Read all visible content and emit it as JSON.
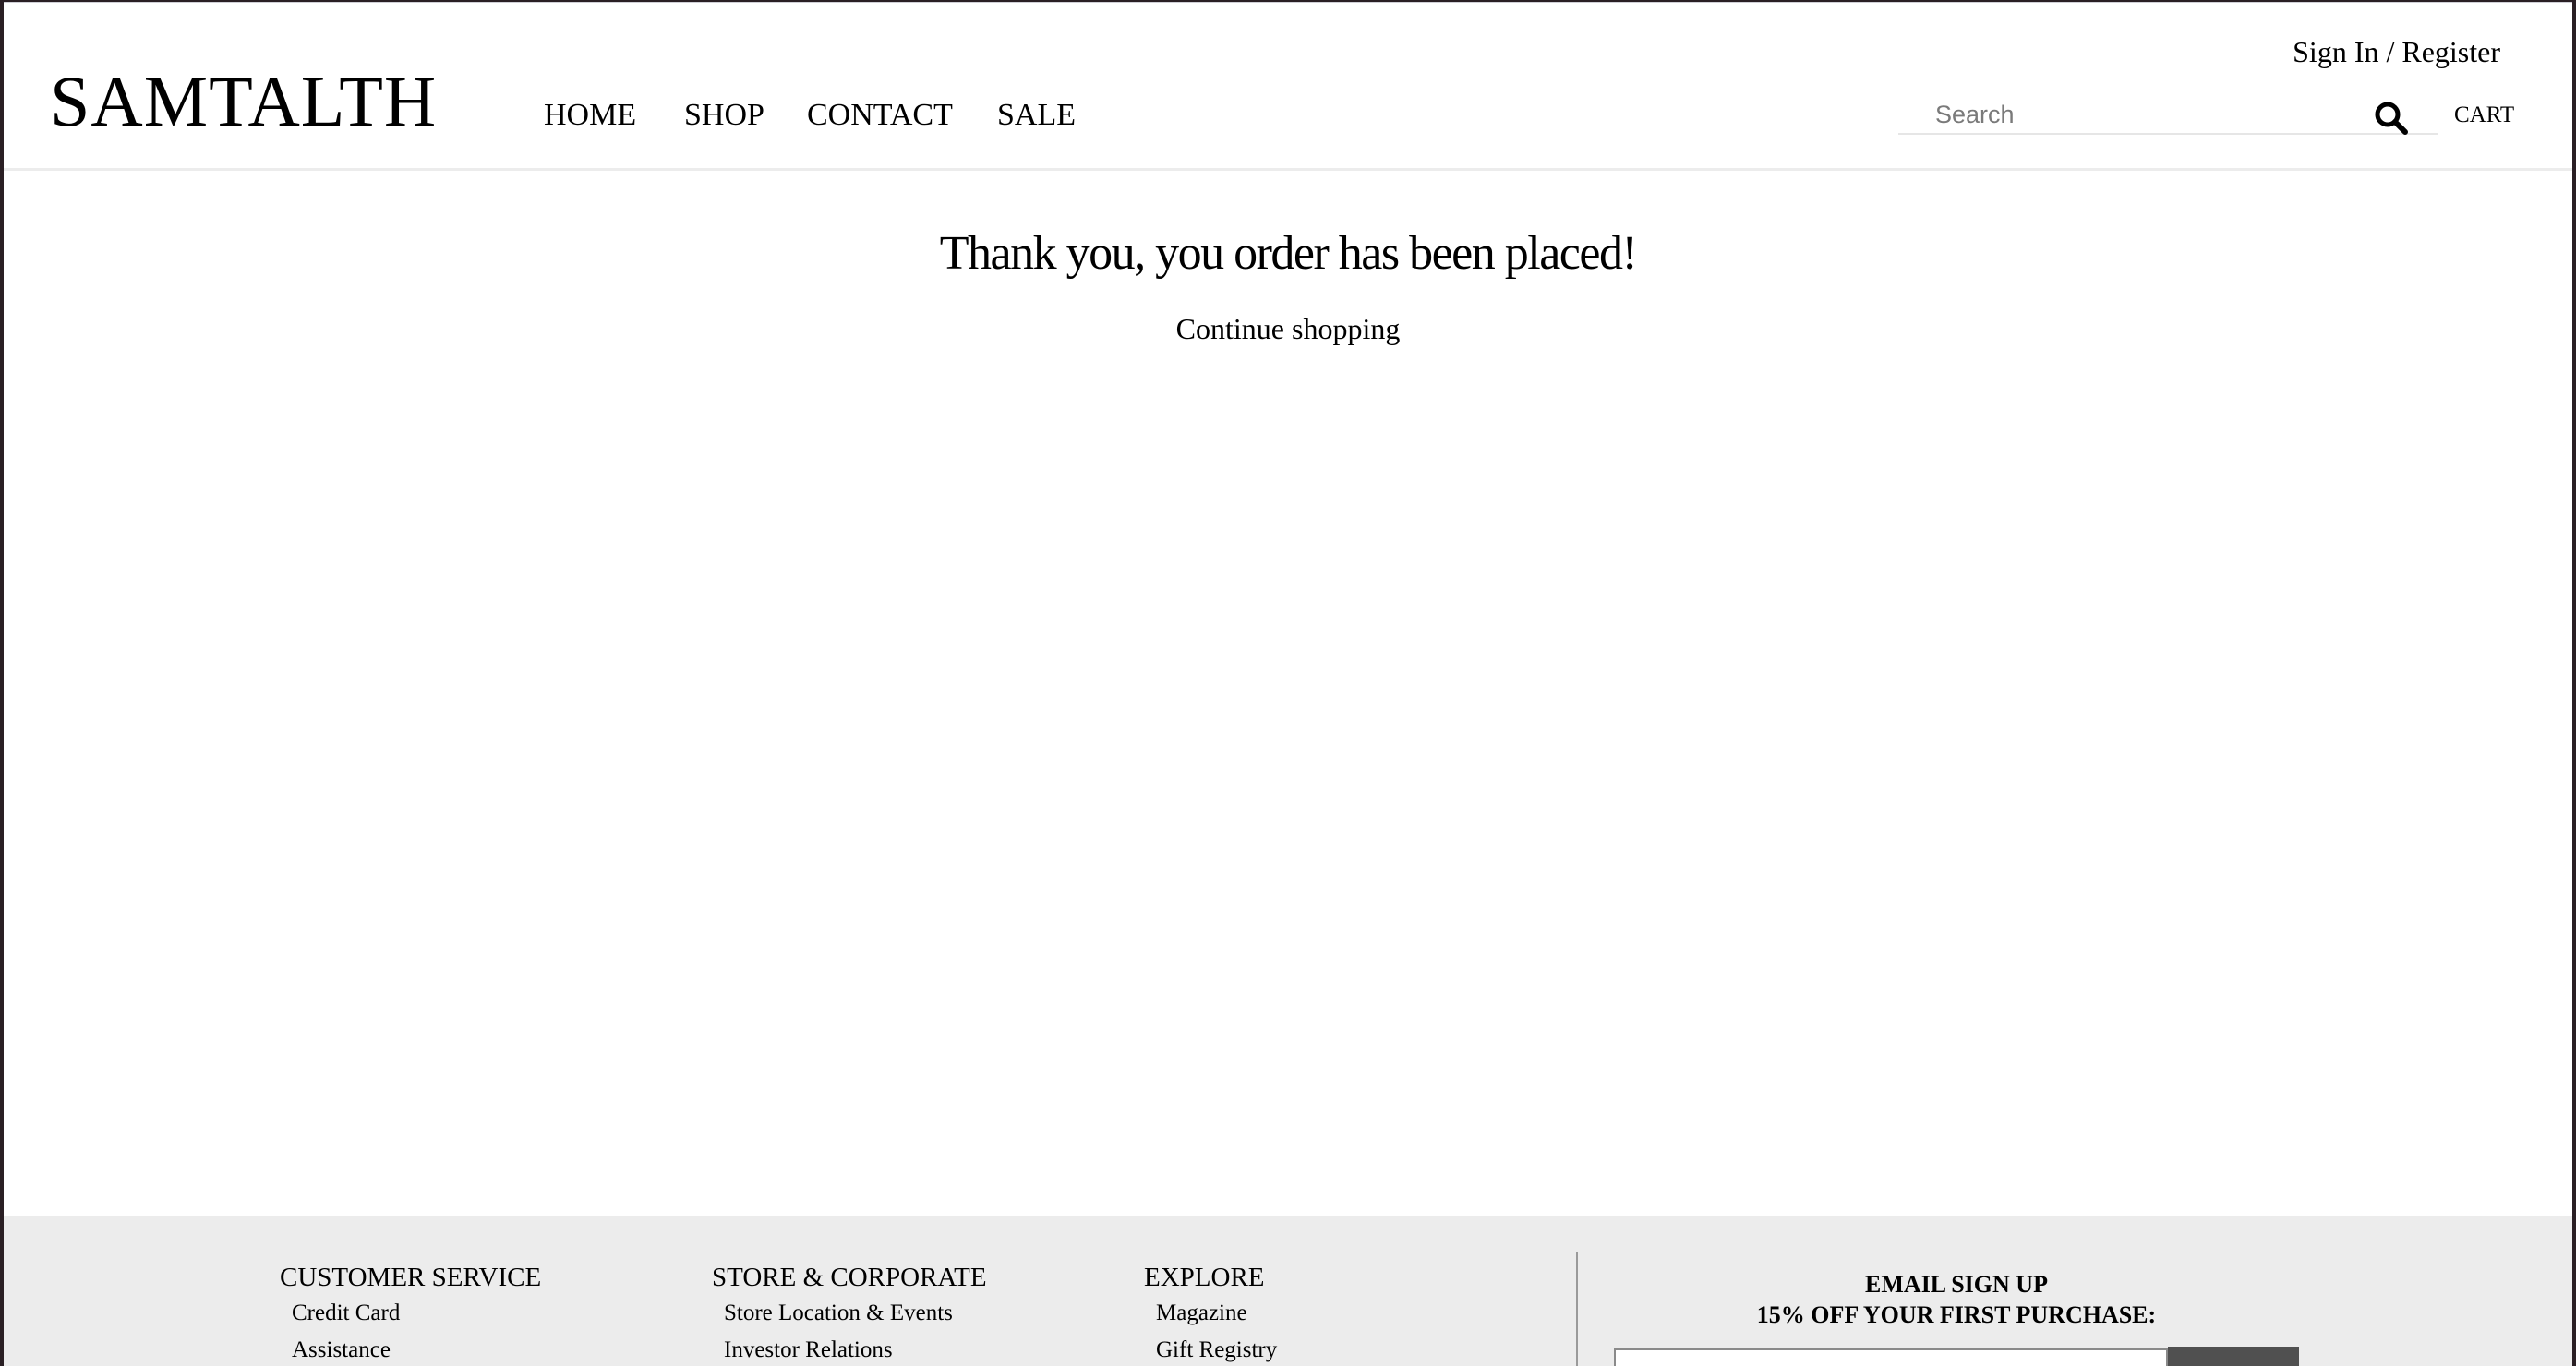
{
  "header": {
    "logo": "SAMTALTH",
    "nav": [
      {
        "label": "HOME"
      },
      {
        "label": "SHOP"
      },
      {
        "label": "CONTACT"
      },
      {
        "label": "SALE"
      }
    ],
    "sign_in": "Sign In / Register",
    "search": {
      "placeholder": "Search",
      "value": "",
      "icon": "search-icon"
    },
    "cart": "CART"
  },
  "main": {
    "heading": "Thank you, you order has been placed!",
    "continue_link": "Continue shopping"
  },
  "footer": {
    "columns": [
      {
        "heading": "CUSTOMER SERVICE",
        "links": [
          "Credit Card",
          "Assistance"
        ]
      },
      {
        "heading": "STORE & CORPORATE",
        "links": [
          "Store Location & Events",
          "Investor Relations"
        ]
      },
      {
        "heading": "EXPLORE",
        "links": [
          "Magazine",
          "Gift Registry"
        ]
      }
    ],
    "signup": {
      "title": "EMAIL SIGN UP",
      "offer": "15% OFF YOUR FIRST PURCHASE:",
      "email_value": ""
    }
  },
  "colors": {
    "background": "#ffffff",
    "footer_bg": "#ececec",
    "submit_bg": "#505050",
    "text": "#000000"
  }
}
